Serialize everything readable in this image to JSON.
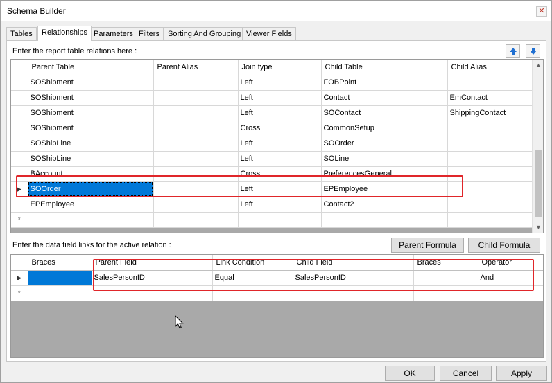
{
  "window": {
    "title": "Schema Builder",
    "close_icon": "close-icon"
  },
  "tabs": [
    "Tables",
    "Relationships",
    "Parameters",
    "Filters",
    "Sorting And Grouping",
    "Viewer Fields"
  ],
  "relations": {
    "label": "Enter the report table relations here :",
    "columns": [
      "Parent Table",
      "Parent Alias",
      "Join type",
      "Child Table",
      "Child Alias"
    ],
    "rows": [
      [
        "SOShipment",
        "",
        "Left",
        "FOBPoint",
        ""
      ],
      [
        "SOShipment",
        "",
        "Left",
        "Contact",
        "EmContact"
      ],
      [
        "SOShipment",
        "",
        "Left",
        "SOContact",
        "ShippingContact"
      ],
      [
        "SOShipment",
        "",
        "Cross",
        "CommonSetup",
        ""
      ],
      [
        "SOShipLine",
        "",
        "Left",
        "SOOrder",
        ""
      ],
      [
        "SOShipLine",
        "",
        "Left",
        "SOLine",
        ""
      ],
      [
        "BAccount",
        "",
        "Cross",
        "PreferencesGeneral",
        ""
      ],
      [
        "SOOrder",
        "",
        "Left",
        "EPEmployee",
        ""
      ],
      [
        "EPEmployee",
        "",
        "Left",
        "Contact2",
        ""
      ]
    ],
    "current_row_marker": "▶",
    "new_row_marker": "*"
  },
  "links": {
    "label": "Enter the data field links for the active relation :",
    "parent_formula_button": "Parent Formula",
    "child_formula_button": "Child Formula",
    "columns": [
      "Braces",
      "Parent Field",
      "Link Condition",
      "Child Field",
      "Braces",
      "Operator"
    ],
    "rows": [
      [
        "",
        "SalesPersonID",
        "Equal",
        "SalesPersonID",
        "",
        "And"
      ]
    ]
  },
  "footer": {
    "ok": "OK",
    "cancel": "Cancel",
    "apply": "Apply"
  },
  "colors": {
    "selection": "#0078d7",
    "highlight_box": "#e0262a",
    "arrow_blue": "#1f6fd1"
  }
}
